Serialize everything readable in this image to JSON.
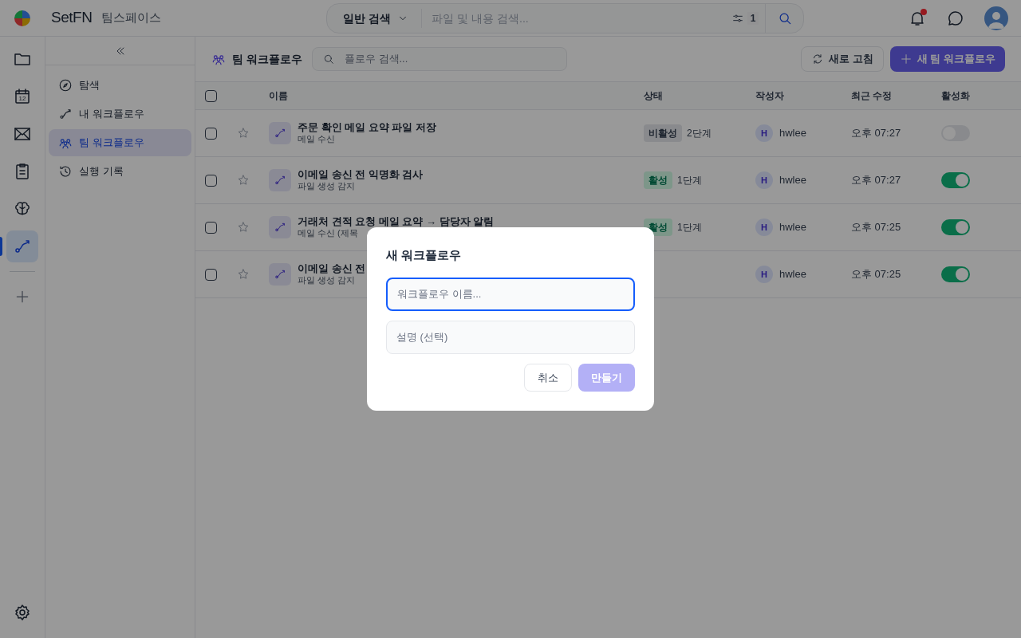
{
  "top_bar": {
    "brand": "SetFN",
    "workspace": "팀스페이스",
    "search": {
      "mode": "일반 검색",
      "placeholder": "파일 및 내용 검색...",
      "filter_count": "1"
    },
    "notifications": {
      "unread": true
    }
  },
  "rail": {
    "items": [
      {
        "kind": "folder",
        "selected": false
      },
      {
        "kind": "calendar",
        "day": "12",
        "selected": false
      },
      {
        "kind": "mail",
        "selected": false
      },
      {
        "kind": "clipboard",
        "selected": false
      },
      {
        "kind": "brain",
        "selected": false
      },
      {
        "kind": "flow",
        "selected": true
      }
    ]
  },
  "sidebar": {
    "items": [
      {
        "kind": "compass",
        "label": "탐색",
        "selected": false
      },
      {
        "kind": "flow",
        "label": "내 워크플로우",
        "selected": false
      },
      {
        "kind": "team",
        "label": "팀 워크플로우",
        "selected": true
      },
      {
        "kind": "history",
        "label": "실행 기록",
        "selected": false
      }
    ]
  },
  "main": {
    "title": "팀 워크플로우",
    "search_placeholder": "플로우 검색...",
    "refresh": "새로 고침",
    "new_button": "새 팀 워크플로우"
  },
  "table": {
    "columns": [
      "이름",
      "상태",
      "작성자",
      "최근 수정",
      "활성화"
    ],
    "select_all": {
      "checked": false
    },
    "rows": [
      {
        "checked": false,
        "name": "주문 확인 메일 요약 파일 저장",
        "trigger": "메일 수신",
        "status": {
          "label": "비활성",
          "active": false
        },
        "steps": "2단계",
        "initial": "H",
        "author": "hwlee",
        "modified": "오후 07:27",
        "enabled": false
      },
      {
        "checked": false,
        "name": "이메일 송신 전 익명화 검사",
        "trigger": "파일 생성 감지",
        "status": {
          "label": "활성",
          "active": true
        },
        "steps": "1단계",
        "initial": "H",
        "author": "hwlee",
        "modified": "오후 07:27",
        "enabled": true
      },
      {
        "checked": false,
        "name": "거래처 견적 요청 메일 요약 → 담당자 알림",
        "trigger": "메일 수신 (제목",
        "status": {
          "label": "활성",
          "active": true
        },
        "steps": "1단계",
        "initial": "H",
        "author": "hwlee",
        "modified": "오후 07:25",
        "enabled": true
      },
      {
        "checked": false,
        "name": "이메일 송신 전",
        "trigger": "파일 생성 감지",
        "initial": "H",
        "author": "hwlee",
        "modified": "오후 07:25",
        "enabled": true
      }
    ]
  },
  "modal": {
    "title": "새 워크플로우",
    "name_placeholder": "워크플로우 이름...",
    "description_placeholder": "설명 (선택)",
    "cancel": "취소",
    "create": {
      "label": "만들기",
      "disabled": true
    }
  }
}
